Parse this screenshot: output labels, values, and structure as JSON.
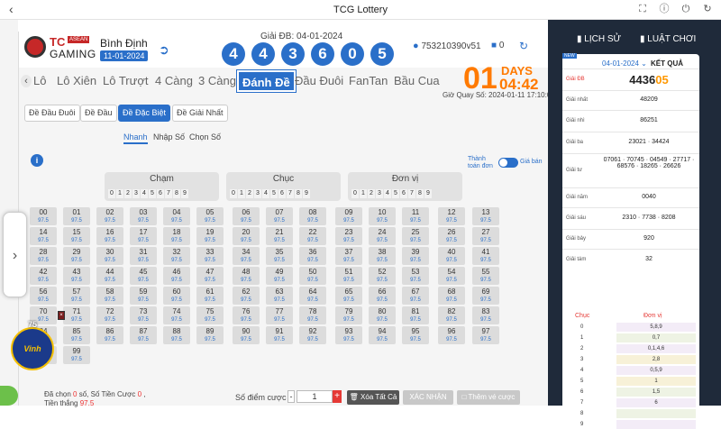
{
  "topbar": {
    "title": "TCG Lottery"
  },
  "header": {
    "brand_tc": "TC",
    "brand_asean": "ASEAN",
    "brand_gaming": "GAMING",
    "province": "Bình Định",
    "province_date": "11-01-2024",
    "gdb_label": "Giải ĐB: 04-01-2024",
    "balls": [
      "4",
      "4",
      "3",
      "6",
      "0",
      "5"
    ],
    "user_id": "753210390v51",
    "wallet_count": "0"
  },
  "tabs": [
    "Lô",
    "Lô Xiên",
    "Lô Trượt",
    "4 Càng",
    "3 Càng",
    "Đánh Đề",
    "Đầu Đuôi",
    "FanTan",
    "Bầu Cua"
  ],
  "countdown": {
    "days_value": "01",
    "days_label": "DAYS",
    "time": "04:42",
    "draw_time": "Giờ Quay Số: 2024-01-11 17:10:00"
  },
  "subtabs": [
    "Đề Đầu Đuôi",
    "Đề Đầu",
    "Đề Đặc Biệt",
    "Đề Giải Nhất"
  ],
  "modes": [
    "Nhanh",
    "Nhập Số",
    "Chọn Số"
  ],
  "toggle": {
    "left": "Thành toán đơn",
    "right": "Giá bán"
  },
  "groups": [
    {
      "title": "Chạm",
      "digits": [
        "0",
        "1",
        "2",
        "3",
        "4",
        "5",
        "6",
        "7",
        "8",
        "9"
      ]
    },
    {
      "title": "Chục",
      "digits": [
        "0",
        "1",
        "2",
        "3",
        "4",
        "5",
        "6",
        "7",
        "8",
        "9"
      ]
    },
    {
      "title": "Đơn vị",
      "digits": [
        "0",
        "1",
        "2",
        "3",
        "4",
        "5",
        "6",
        "7",
        "8",
        "9"
      ]
    }
  ],
  "odds": "97.5",
  "bottom": {
    "selected_prefix": "Đã chọn ",
    "selected_count": "0",
    "selected_suffix": " số,",
    "bet_label": "Số Tiền Cược ",
    "bet_value": "0",
    "bet_suffix": " ,",
    "win_label": "Tiền thắng ",
    "win_value": "97.5",
    "points_label": "Số điểm cược",
    "minus": "-",
    "qty": "1",
    "plus": "+",
    "clear_all": "Xóa Tất Cả",
    "confirm": "XÁC NHẬN",
    "add_to_bet": "Thêm vé cược"
  },
  "rightpanel": {
    "history": "LỊCH SỬ",
    "rules": "LUẬT CHƠI",
    "new_badge": "NEW",
    "result_date": "04-01-2024",
    "result_title": "KẾT QUẢ",
    "prizes": [
      {
        "label": "Giải ĐB",
        "value": "4436",
        "value_hl": "05"
      },
      {
        "label": "Giải nhất",
        "value": "48209"
      },
      {
        "label": "Giải nhì",
        "value": "86251"
      },
      {
        "label": "Giải ba",
        "value": "23021 · 34424"
      },
      {
        "label": "Giải tư",
        "value": "07061 · 70745 · 04549 · 27717 · 68576 · 18265 · 26626"
      },
      {
        "label": "Giải năm",
        "value": "0040"
      },
      {
        "label": "Giải sáu",
        "value": "2310 · 7738 · 8208"
      },
      {
        "label": "Giải bảy",
        "value": "920"
      },
      {
        "label": "Giải tám",
        "value": "32"
      }
    ],
    "chuc_header": "Chục",
    "donvi_header": "Đơn vị",
    "chuc_rows": [
      {
        "c": "0",
        "d": "5,8,9"
      },
      {
        "c": "1",
        "d": "0,7"
      },
      {
        "c": "2",
        "d": "0,1,4,6"
      },
      {
        "c": "3",
        "d": "2,8"
      },
      {
        "c": "4",
        "d": "0,5,9"
      },
      {
        "c": "5",
        "d": "1"
      },
      {
        "c": "6",
        "d": "1,5"
      },
      {
        "c": "7",
        "d": "6"
      },
      {
        "c": "8",
        "d": ""
      },
      {
        "c": "9",
        "d": ""
      }
    ]
  },
  "game_logo": {
    "top": "75",
    "name": "Vinh"
  },
  "colors": {
    "accent": "#2a6fc9",
    "orange": "#ff7a00",
    "red": "#e53935",
    "dark": "#1f2a3a"
  }
}
